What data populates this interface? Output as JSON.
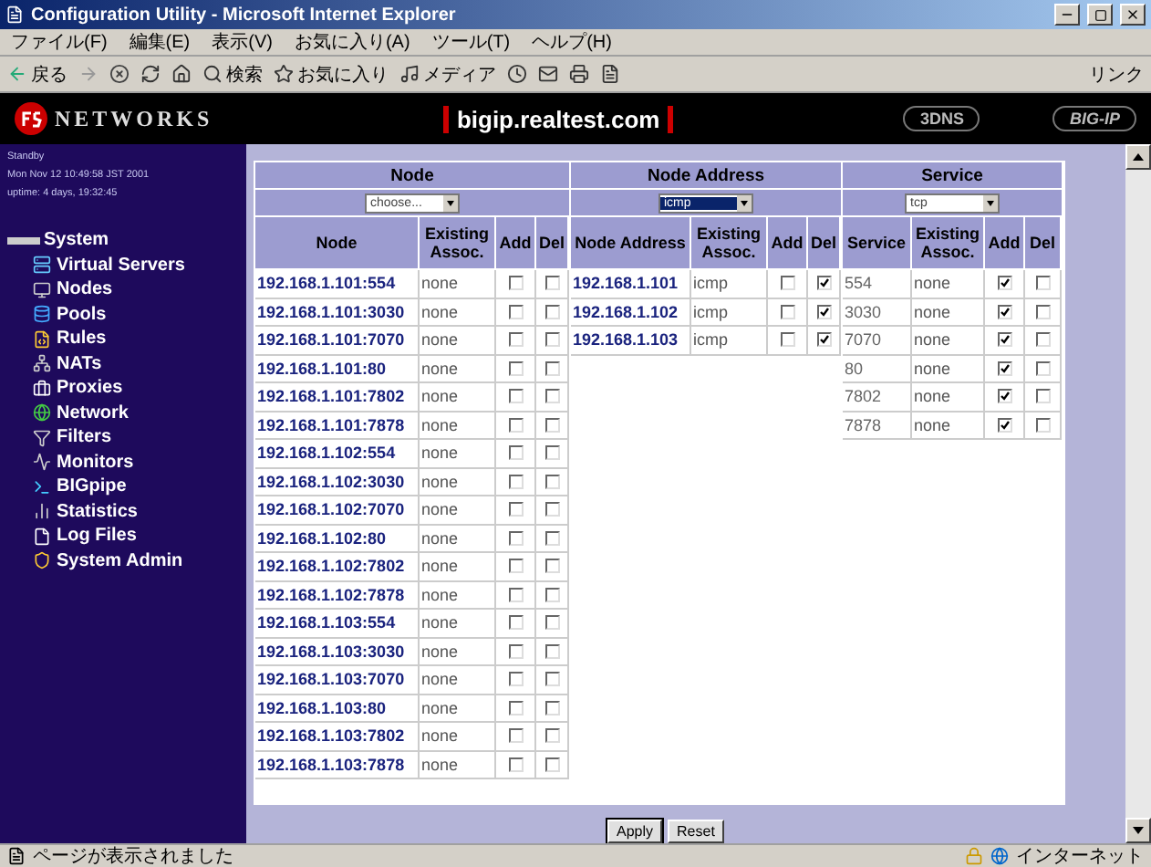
{
  "window": {
    "title": "Configuration Utility - Microsoft Internet Explorer"
  },
  "menu": [
    "ファイル(F)",
    "編集(E)",
    "表示(V)",
    "お気に入り(A)",
    "ツール(T)",
    "ヘルプ(H)"
  ],
  "toolbar": {
    "back": "戻る",
    "search": "検索",
    "favorites": "お気に入り",
    "media": "メディア",
    "links": "リンク"
  },
  "header": {
    "brand": "NETWORKS",
    "host": "bigip.realtest.com",
    "product_1": "3DNS",
    "product_2": "BIG-IP"
  },
  "sidebar": {
    "status": "Standby",
    "date": "Mon Nov 12 10:49:58 JST 2001",
    "uptime": "uptime: 4 days, 19:32:45",
    "items": [
      {
        "label": "System",
        "children": [
          {
            "label": "Virtual Servers"
          },
          {
            "label": "Nodes"
          },
          {
            "label": "Pools"
          },
          {
            "label": "Rules"
          },
          {
            "label": "NATs"
          },
          {
            "label": "Proxies"
          },
          {
            "label": "Network"
          },
          {
            "label": "Filters"
          },
          {
            "label": "Monitors"
          },
          {
            "label": "BIGpipe"
          },
          {
            "label": "Statistics"
          },
          {
            "label": "Log Files"
          },
          {
            "label": "System Admin"
          }
        ]
      }
    ]
  },
  "groups": [
    {
      "title": "Node",
      "select": "choose...",
      "select_selected": false,
      "columns": [
        "Node",
        "Existing Assoc.",
        "Add",
        "Del"
      ],
      "rows": [
        {
          "name": "192.168.1.101:554",
          "existing": "none",
          "add": false,
          "del": false
        },
        {
          "name": "192.168.1.101:3030",
          "existing": "none",
          "add": false,
          "del": false
        },
        {
          "name": "192.168.1.101:7070",
          "existing": "none",
          "add": false,
          "del": false
        },
        {
          "name": "192.168.1.101:80",
          "existing": "none",
          "add": false,
          "del": false
        },
        {
          "name": "192.168.1.101:7802",
          "existing": "none",
          "add": false,
          "del": false
        },
        {
          "name": "192.168.1.101:7878",
          "existing": "none",
          "add": false,
          "del": false
        },
        {
          "name": "192.168.1.102:554",
          "existing": "none",
          "add": false,
          "del": false
        },
        {
          "name": "192.168.1.102:3030",
          "existing": "none",
          "add": false,
          "del": false
        },
        {
          "name": "192.168.1.102:7070",
          "existing": "none",
          "add": false,
          "del": false
        },
        {
          "name": "192.168.1.102:80",
          "existing": "none",
          "add": false,
          "del": false
        },
        {
          "name": "192.168.1.102:7802",
          "existing": "none",
          "add": false,
          "del": false
        },
        {
          "name": "192.168.1.102:7878",
          "existing": "none",
          "add": false,
          "del": false
        },
        {
          "name": "192.168.1.103:554",
          "existing": "none",
          "add": false,
          "del": false
        },
        {
          "name": "192.168.1.103:3030",
          "existing": "none",
          "add": false,
          "del": false
        },
        {
          "name": "192.168.1.103:7070",
          "existing": "none",
          "add": false,
          "del": false
        },
        {
          "name": "192.168.1.103:80",
          "existing": "none",
          "add": false,
          "del": false
        },
        {
          "name": "192.168.1.103:7802",
          "existing": "none",
          "add": false,
          "del": false
        },
        {
          "name": "192.168.1.103:7878",
          "existing": "none",
          "add": false,
          "del": false
        }
      ]
    },
    {
      "title": "Node Address",
      "select": "icmp",
      "select_selected": true,
      "columns": [
        "Node Address",
        "Existing Assoc.",
        "Add",
        "Del"
      ],
      "rows": [
        {
          "name": "192.168.1.101",
          "existing": "icmp",
          "add": false,
          "del": true
        },
        {
          "name": "192.168.1.102",
          "existing": "icmp",
          "add": false,
          "del": true
        },
        {
          "name": "192.168.1.103",
          "existing": "icmp",
          "add": false,
          "del": true
        }
      ]
    },
    {
      "title": "Service",
      "select": "tcp",
      "select_selected": false,
      "columns": [
        "Service",
        "Existing Assoc.",
        "Add",
        "Del"
      ],
      "rows": [
        {
          "name": "554",
          "existing": "none",
          "add": true,
          "del": false
        },
        {
          "name": "3030",
          "existing": "none",
          "add": true,
          "del": false
        },
        {
          "name": "7070",
          "existing": "none",
          "add": true,
          "del": false
        },
        {
          "name": "80",
          "existing": "none",
          "add": true,
          "del": false
        },
        {
          "name": "7802",
          "existing": "none",
          "add": true,
          "del": false
        },
        {
          "name": "7878",
          "existing": "none",
          "add": true,
          "del": false
        }
      ]
    }
  ],
  "buttons": [
    "Apply",
    "Reset"
  ],
  "status_bar": {
    "message": "ページが表示されました",
    "zone": "インターネット"
  }
}
